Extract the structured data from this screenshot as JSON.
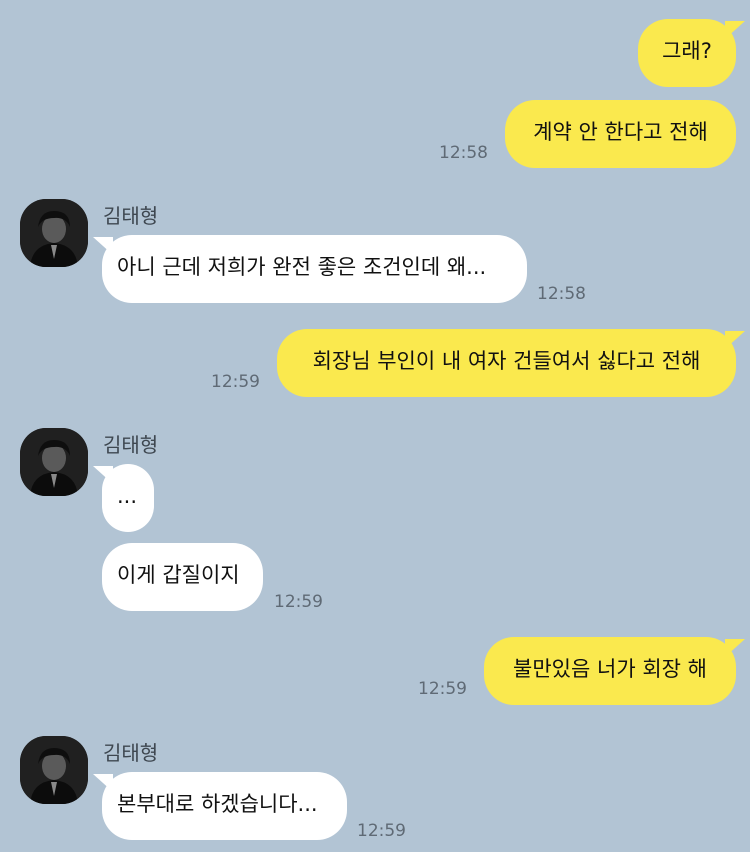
{
  "contact": {
    "name": "김태형"
  },
  "messages": [
    {
      "side": "me",
      "text": "그래?"
    },
    {
      "side": "me",
      "text": "계약 안 한다고 전해",
      "time": "12:58"
    },
    {
      "side": "them",
      "text": "아니 근데 저희가 완전 좋은 조건인데 왜...",
      "time": "12:58"
    },
    {
      "side": "me",
      "text": "회장님 부인이 내 여자 건들여서 싫다고 전해",
      "time": "12:59"
    },
    {
      "side": "them",
      "text": "..."
    },
    {
      "side": "them",
      "text": "이게 갑질이지",
      "time": "12:59"
    },
    {
      "side": "me",
      "text": "불만있음 너가 회장 해",
      "time": "12:59"
    },
    {
      "side": "them",
      "text": "본부대로 하겠습니다...",
      "time": "12:59"
    }
  ],
  "colors": {
    "background": "#b2c4d4",
    "sent_bubble": "#fae94e",
    "received_bubble": "#ffffff"
  }
}
